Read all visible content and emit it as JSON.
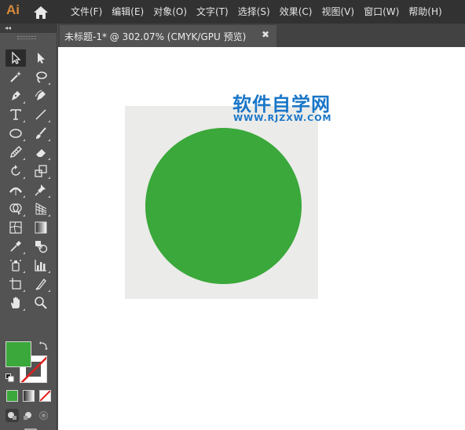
{
  "app": {
    "logo": "Ai",
    "home_icon": "home-icon"
  },
  "menu": [
    "文件(F)",
    "编辑(E)",
    "对象(O)",
    "文字(T)",
    "选择(S)",
    "效果(C)",
    "视图(V)",
    "窗口(W)",
    "帮助(H)"
  ],
  "document": {
    "tab_title": "未标题-1* @ 302.07% (CMYK/GPU 预览)",
    "close_glyph": "✖"
  },
  "toolbar": {
    "collapse_glyph": "◂◂",
    "tools": [
      "selection-tool",
      "direct-selection-tool",
      "magic-wand-tool",
      "lasso-tool",
      "pen-tool",
      "curvature-tool",
      "type-tool",
      "line-segment-tool",
      "ellipse-tool",
      "paintbrush-tool",
      "pencil-tool",
      "eraser-tool",
      "rotate-tool",
      "scale-tool",
      "width-tool",
      "puppet-warp-tool",
      "shape-builder-tool",
      "perspective-grid-tool",
      "mesh-tool",
      "gradient-tool",
      "eyedropper-tool",
      "blend-tool",
      "symbol-sprayer-tool",
      "column-graph-tool",
      "artboard-tool",
      "slice-tool",
      "hand-tool",
      "zoom-tool"
    ],
    "active_tool": "selection-tool",
    "fill_color": "#3aa83a",
    "stroke_color": "none"
  },
  "canvas": {
    "background": "#ffffff",
    "artboard_color": "#ebebe9",
    "circle_color": "#3aa83a"
  },
  "watermark": {
    "title": "软件自学网",
    "url": "WWW.RJZXW.COM",
    "color": "#1976c8"
  }
}
